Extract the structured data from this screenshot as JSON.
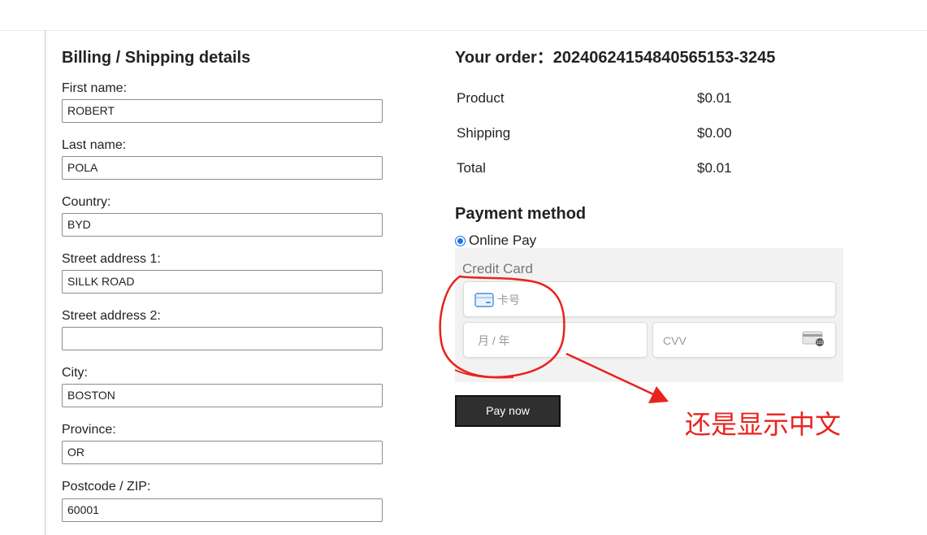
{
  "billing": {
    "title": "Billing / Shipping details",
    "fields": [
      {
        "label": "First name:",
        "value": "ROBERT"
      },
      {
        "label": "Last name:",
        "value": "POLA"
      },
      {
        "label": "Country:",
        "value": "BYD"
      },
      {
        "label": "Street address 1:",
        "value": "SILLK ROAD"
      },
      {
        "label": "Street address 2:",
        "value": ""
      },
      {
        "label": "City:",
        "value": "BOSTON"
      },
      {
        "label": "Province:",
        "value": "OR"
      },
      {
        "label": "Postcode / ZIP:",
        "value": "60001"
      }
    ]
  },
  "order": {
    "title": "Your order：20240624154840565153-3245",
    "rows": [
      {
        "label": "Product",
        "value": "$0.01"
      },
      {
        "label": "Shipping",
        "value": "$0.00"
      },
      {
        "label": "Total",
        "value": "$0.01"
      }
    ]
  },
  "payment": {
    "title": "Payment method",
    "option": "Online Pay",
    "card_panel_title": "Credit Card",
    "card_number_placeholder": "卡号",
    "expiry_placeholder": "月 / 年",
    "cvv_placeholder": "CVV",
    "pay_button": "Pay now"
  },
  "annotation": {
    "text": "还是显示中文",
    "color": "#e8231e"
  },
  "colors": {
    "accent": "#1a73e8",
    "button_bg": "#2f2f2f"
  }
}
